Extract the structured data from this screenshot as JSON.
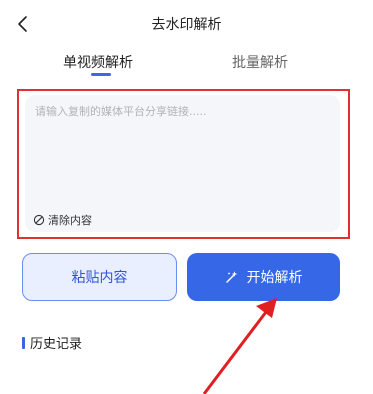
{
  "header": {
    "title": "去水印解析"
  },
  "tabs": [
    {
      "label": "单视频解析",
      "active": true
    },
    {
      "label": "批量解析",
      "active": false
    }
  ],
  "input": {
    "placeholder": "请输入复制的媒体平台分享链接.....",
    "value": "",
    "clear_label": "清除内容"
  },
  "buttons": {
    "paste_label": "粘贴内容",
    "start_label": "开始解析"
  },
  "history": {
    "title": "历史记录"
  },
  "colors": {
    "accent": "#3567e7",
    "highlight_frame": "#e03131",
    "paste_bg": "#e9efff",
    "input_bg": "#f5f6fa"
  },
  "icons": {
    "back": "chevron-left-icon",
    "clear": "eraser-icon",
    "start": "magic-wand-icon"
  }
}
